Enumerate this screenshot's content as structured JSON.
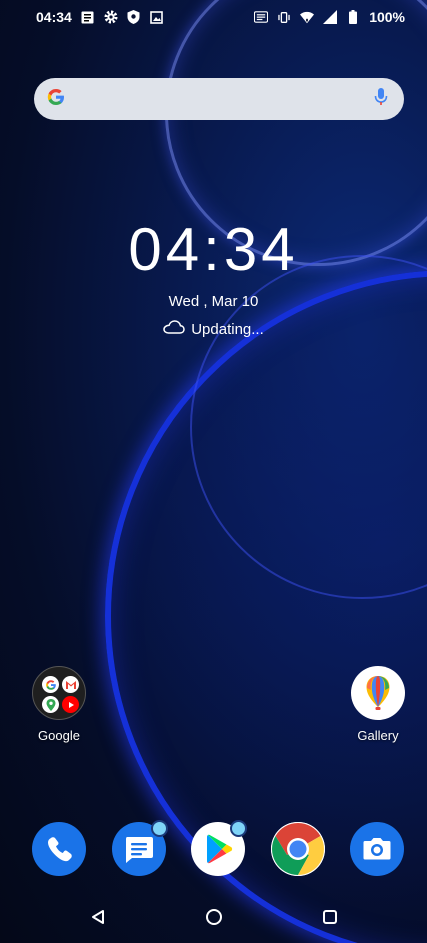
{
  "status_bar": {
    "time": "04:34",
    "battery": "100%",
    "left_icons": [
      "notes-icon",
      "settings-icon",
      "shield-icon",
      "image-icon"
    ],
    "right_icons": [
      "hd-icon",
      "vibrate-icon",
      "wifi-icon",
      "signal-icon",
      "battery-icon"
    ]
  },
  "search": {
    "logo": "google-g-icon",
    "mic": "mic-icon"
  },
  "clock": {
    "time": "04:34",
    "date": "Wed , Mar 10",
    "weather": "Updating..."
  },
  "home_apps": [
    {
      "label": "Google",
      "icon": "google-folder-icon"
    },
    {
      "label": "Gallery",
      "icon": "gallery-icon"
    }
  ],
  "dock": [
    {
      "name": "phone",
      "icon": "phone-icon",
      "badge": false,
      "color": "#1a73e8"
    },
    {
      "name": "messages",
      "icon": "messages-icon",
      "badge": true,
      "color": "#1a73e8"
    },
    {
      "name": "play-store",
      "icon": "play-store-icon",
      "badge": true,
      "color": "#ffffff"
    },
    {
      "name": "chrome",
      "icon": "chrome-icon",
      "badge": false,
      "color": "#ffffff"
    },
    {
      "name": "camera",
      "icon": "camera-icon",
      "badge": false,
      "color": "#1a73e8"
    }
  ],
  "navbar": [
    "back-icon",
    "home-icon",
    "recents-icon"
  ]
}
